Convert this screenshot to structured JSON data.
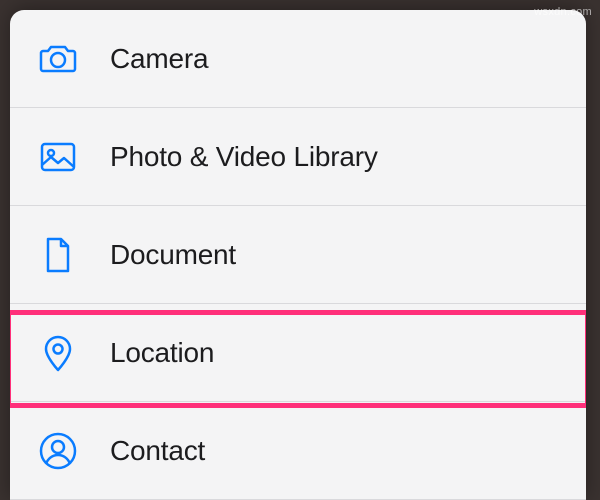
{
  "watermark": "wsxdn.com",
  "colors": {
    "accent": "#0a7cff",
    "highlight": "#ff2f7a",
    "sheet_bg": "#f4f4f5",
    "text": "#1c1c1e",
    "divider": "#d9d9dc"
  },
  "menu": {
    "items": [
      {
        "icon": "camera-icon",
        "label": "Camera"
      },
      {
        "icon": "photo-icon",
        "label": "Photo & Video Library"
      },
      {
        "icon": "document-icon",
        "label": "Document"
      },
      {
        "icon": "location-icon",
        "label": "Location"
      },
      {
        "icon": "contact-icon",
        "label": "Contact"
      }
    ],
    "highlighted_index": 3
  }
}
